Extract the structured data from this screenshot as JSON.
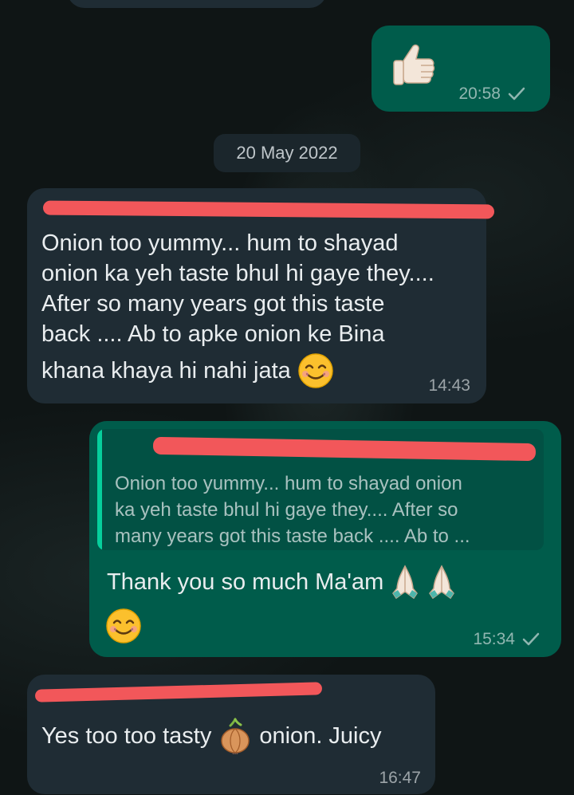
{
  "date_separator": "20 May 2022",
  "messages": [
    {
      "direction": "outgoing",
      "content": "thumbs-up-emoji",
      "time": "20:58",
      "status": "sent"
    },
    {
      "direction": "incoming",
      "sender": "[redacted]",
      "text": "Onion too yummy... hum to shayad onion ka yeh taste bhul hi gaye they.... After so many years got this taste back .... Ab to apke onion ke Bina khana khaya hi nahi jata",
      "lines": [
        "Onion too yummy... hum to shayad",
        "onion ka yeh taste bhul hi gaye they....",
        "After so many years got this taste",
        "back .... Ab to apke onion ke Bina",
        "khana khaya hi nahi jata"
      ],
      "trailing_emoji": "smiling-face-emoji",
      "time": "14:43"
    },
    {
      "direction": "outgoing",
      "quoted_sender": "[redacted]",
      "quoted_lines": [
        "Onion too yummy... hum to shayad onion",
        "ka yeh taste bhul hi gaye they.... After so",
        "many years got this taste back .... Ab to ..."
      ],
      "text": "Thank you so much Ma'am",
      "trailing_emoji": [
        "folded-hands-emoji",
        "folded-hands-emoji",
        "smiling-face-emoji"
      ],
      "time": "15:34",
      "status": "sent"
    },
    {
      "direction": "incoming",
      "sender": "[redacted]",
      "text_before": "Yes too too tasty",
      "inline_emoji": "onion-emoji",
      "text_after": "onion. Juicy",
      "time": "16:47"
    }
  ],
  "colors": {
    "incoming_bubble": "#1f2c34",
    "outgoing_bubble": "#005c4b",
    "redaction": "#f2575a",
    "quote_accent": "#06cf9c"
  }
}
